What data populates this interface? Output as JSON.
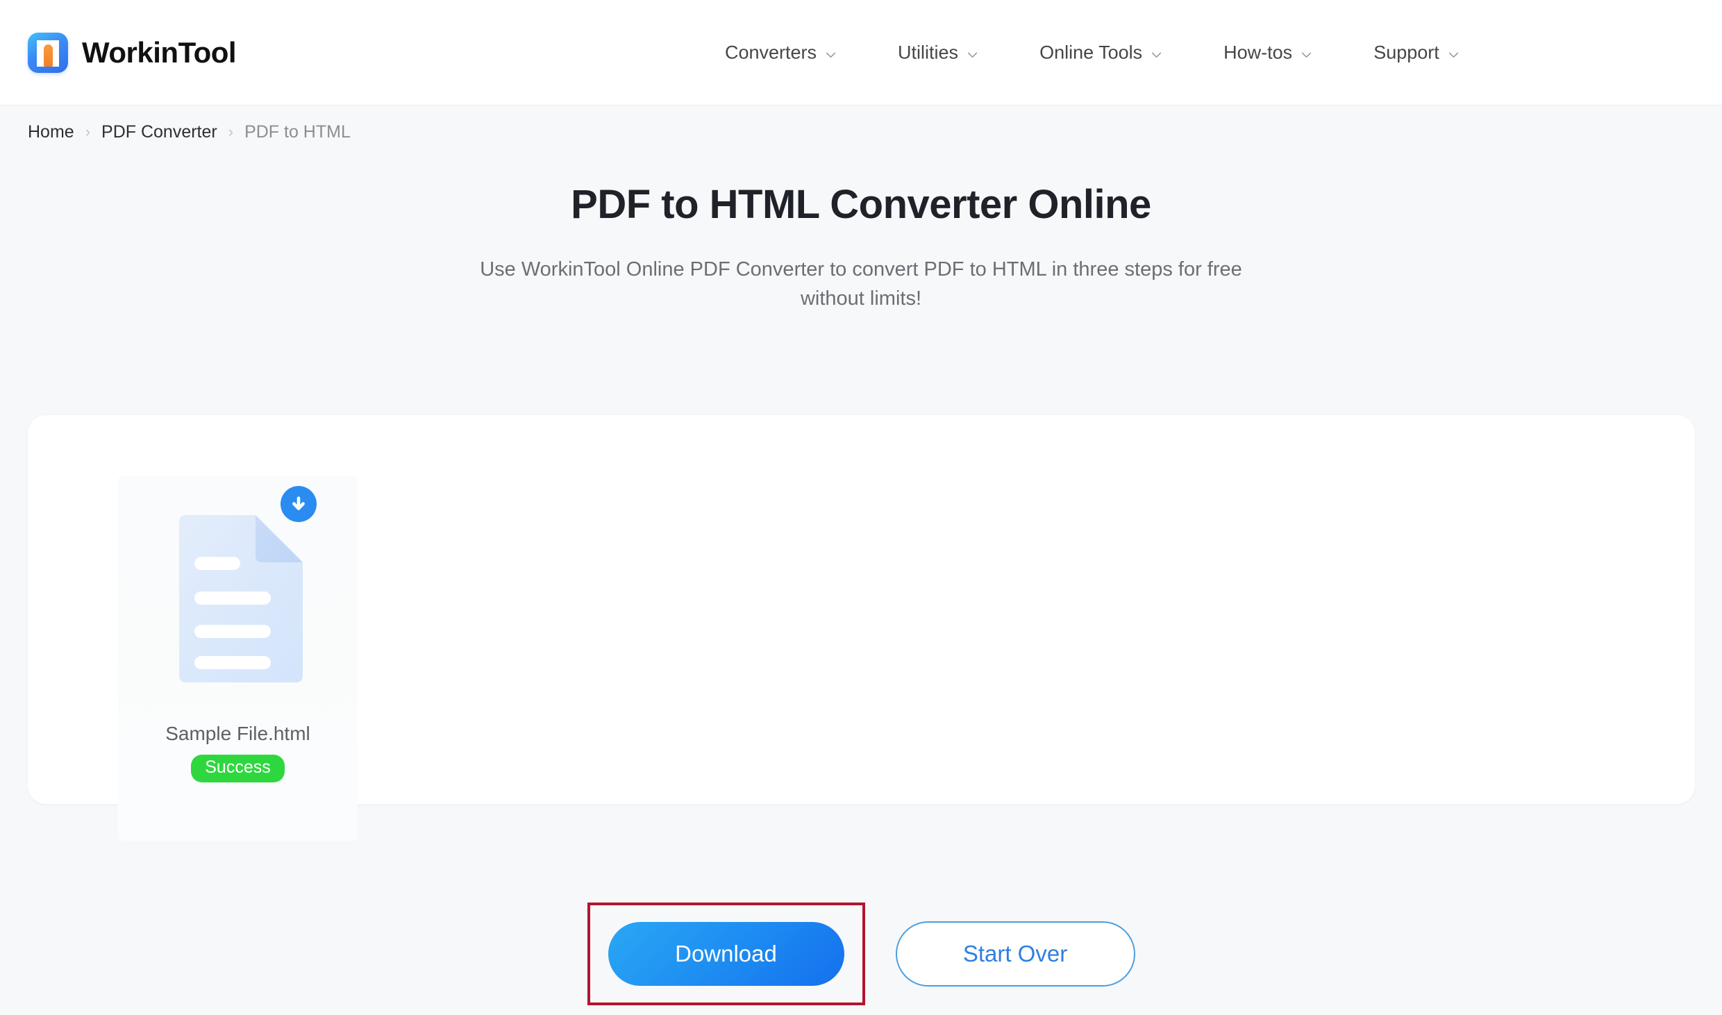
{
  "header": {
    "brand_name": "WorkinTool",
    "logo_icon": "workintool-logo-icon",
    "nav": [
      {
        "label": "Converters",
        "icon": "chevron-down-icon"
      },
      {
        "label": "Utilities",
        "icon": "chevron-down-icon"
      },
      {
        "label": "Online Tools",
        "icon": "chevron-down-icon"
      },
      {
        "label": "How-tos",
        "icon": "chevron-down-icon"
      },
      {
        "label": "Support",
        "icon": "chevron-down-icon"
      }
    ]
  },
  "breadcrumb": {
    "items": [
      "Home",
      "PDF Converter",
      "PDF to HTML"
    ],
    "separator": "›"
  },
  "hero": {
    "title": "PDF to HTML Converter Online",
    "subtitle": "Use WorkinTool Online PDF Converter to convert PDF to HTML in three steps for free without limits!"
  },
  "file_card": {
    "file_icon": "document-icon",
    "download_badge_icon": "download-circle-icon",
    "file_name": "Sample File.html",
    "status": "Success",
    "status_color": "#2fd73f"
  },
  "actions": {
    "download_label": "Download",
    "start_over_label": "Start Over",
    "highlight_color": "#b5132f",
    "download_gradient_from": "#2aa7f5",
    "download_gradient_to": "#1470ee",
    "start_over_border_color": "#4a9fe0",
    "start_over_text_color": "#2e7fe0"
  }
}
